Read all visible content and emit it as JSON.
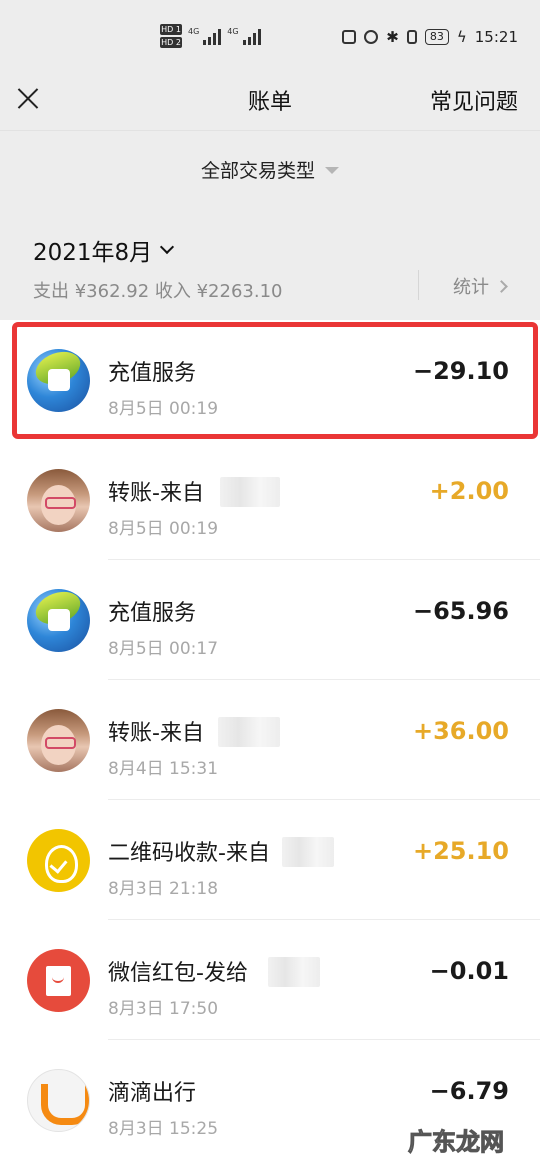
{
  "status_bar": {
    "hd1": "HD 1",
    "hd2": "HD 2",
    "net1": "4G",
    "net2": "4G",
    "battery": "83",
    "time": "15:21"
  },
  "nav": {
    "close_icon": "close-icon",
    "title": "账单",
    "right_label": "常见问题"
  },
  "filter": {
    "label": "全部交易类型"
  },
  "month": {
    "title": "2021年8月",
    "summary": "支出 ¥362.92 收入 ¥2263.10",
    "stats_label": "统计"
  },
  "transactions": [
    {
      "title": "充值服务",
      "time": "8月5日 00:19",
      "amount": "−29.10",
      "type": "expense",
      "icon": "recharge-service-icon",
      "highlighted": true
    },
    {
      "title": "转账-来自",
      "time": "8月5日 00:19",
      "amount": "+2.00",
      "type": "income",
      "icon": "user-avatar"
    },
    {
      "title": "充值服务",
      "time": "8月5日 00:17",
      "amount": "−65.96",
      "type": "expense",
      "icon": "recharge-service-icon"
    },
    {
      "title": "转账-来自",
      "time": "8月4日 15:31",
      "amount": "+36.00",
      "type": "income",
      "icon": "user-avatar"
    },
    {
      "title": "二维码收款-来自",
      "time": "8月3日 21:18",
      "amount": "+25.10",
      "type": "income",
      "icon": "qr-payment-icon"
    },
    {
      "title": "微信红包-发给",
      "time": "8月3日 17:50",
      "amount": "−0.01",
      "type": "expense",
      "icon": "red-packet-icon"
    },
    {
      "title": "滴滴出行",
      "time": "8月3日 15:25",
      "amount": "−6.79",
      "type": "expense",
      "icon": "didi-icon"
    }
  ],
  "colors": {
    "income": "#e7a928",
    "expense": "#1a1a1a",
    "highlight": "#ea3636"
  },
  "watermark": "广东龙网"
}
